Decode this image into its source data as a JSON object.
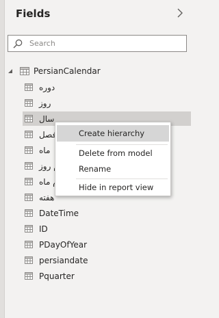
{
  "panel": {
    "title": "Fields",
    "collapse_icon": "chevron-right-icon"
  },
  "search": {
    "placeholder": "Search",
    "value": "",
    "icon": "search-icon"
  },
  "table": {
    "name": "PersianCalendar",
    "expanded": true,
    "icon": "table-icon",
    "fields": [
      {
        "label": "دوره",
        "selected": false,
        "icon": "field-icon"
      },
      {
        "label": "روز",
        "selected": false,
        "icon": "field-icon"
      },
      {
        "label": "سال",
        "selected": true,
        "icon": "field-icon"
      },
      {
        "label": "فصل",
        "selected": false,
        "icon": "field-icon"
      },
      {
        "label": "ماه",
        "selected": false,
        "icon": "field-icon"
      },
      {
        "label": "نام روز",
        "selected": false,
        "icon": "field-icon"
      },
      {
        "label": "نام ماه",
        "selected": false,
        "icon": "field-icon"
      },
      {
        "label": "هفته",
        "selected": false,
        "icon": "field-icon"
      },
      {
        "label": "DateTime",
        "selected": false,
        "icon": "field-icon"
      },
      {
        "label": "ID",
        "selected": false,
        "icon": "field-icon"
      },
      {
        "label": "PDayOfYear",
        "selected": false,
        "icon": "field-icon"
      },
      {
        "label": "persiandate",
        "selected": false,
        "icon": "field-icon"
      },
      {
        "label": "Pquarter",
        "selected": false,
        "icon": "field-icon"
      }
    ]
  },
  "context_menu": {
    "items": [
      {
        "label": "Create hierarchy",
        "highlighted": true
      },
      {
        "label": "Delete from model",
        "highlighted": false
      },
      {
        "label": "Rename",
        "highlighted": false
      },
      {
        "label": "Hide in report view",
        "highlighted": false
      }
    ]
  },
  "colors": {
    "panel_bg": "#f3f2f1",
    "selected_row": "#d2d0ce",
    "menu_highlight": "#d6d6d6",
    "text": "#252423",
    "icon_gray": "#8a8886"
  }
}
